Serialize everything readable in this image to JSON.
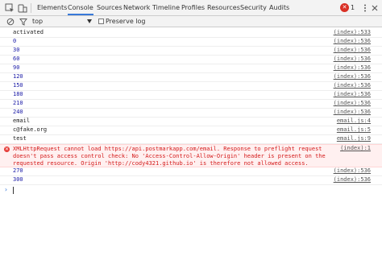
{
  "tabs": [
    "Elements",
    "Console",
    "Sources",
    "Network",
    "Timeline",
    "Profiles",
    "Resources",
    "Security",
    "Audits"
  ],
  "active_tab": "Console",
  "error_count": "1",
  "toolbar": {
    "context": "top",
    "preserve_log": "Preserve log"
  },
  "messages": [
    {
      "text": "activated",
      "source": "(index):533",
      "numeric": false
    },
    {
      "text": "0",
      "source": "(index):536",
      "numeric": true
    },
    {
      "text": "30",
      "source": "(index):536",
      "numeric": true
    },
    {
      "text": "60",
      "source": "(index):536",
      "numeric": true
    },
    {
      "text": "90",
      "source": "(index):536",
      "numeric": true
    },
    {
      "text": "120",
      "source": "(index):536",
      "numeric": true
    },
    {
      "text": "150",
      "source": "(index):536",
      "numeric": true
    },
    {
      "text": "180",
      "source": "(index):536",
      "numeric": true
    },
    {
      "text": "210",
      "source": "(index):536",
      "numeric": true
    },
    {
      "text": "240",
      "source": "(index):536",
      "numeric": true
    },
    {
      "text": "email",
      "source": "email.js:4",
      "numeric": false
    },
    {
      "text": "c@fake.org",
      "source": "email.js:5",
      "numeric": false
    },
    {
      "text": "test",
      "source": "email.js:9",
      "numeric": false
    }
  ],
  "error_message": {
    "text": "XMLHttpRequest cannot load https://api.postmarkapp.com/email. Response to preflight request doesn't pass access control check: No 'Access-Control-Allow-Origin' header is present on the requested resource. Origin 'http://cody4321.github.io' is therefore not allowed access.",
    "source": "(index):1"
  },
  "messages_after": [
    {
      "text": "270",
      "source": "(index):536",
      "numeric": true
    },
    {
      "text": "300",
      "source": "(index):536",
      "numeric": true
    }
  ],
  "prompt_symbol": "›"
}
